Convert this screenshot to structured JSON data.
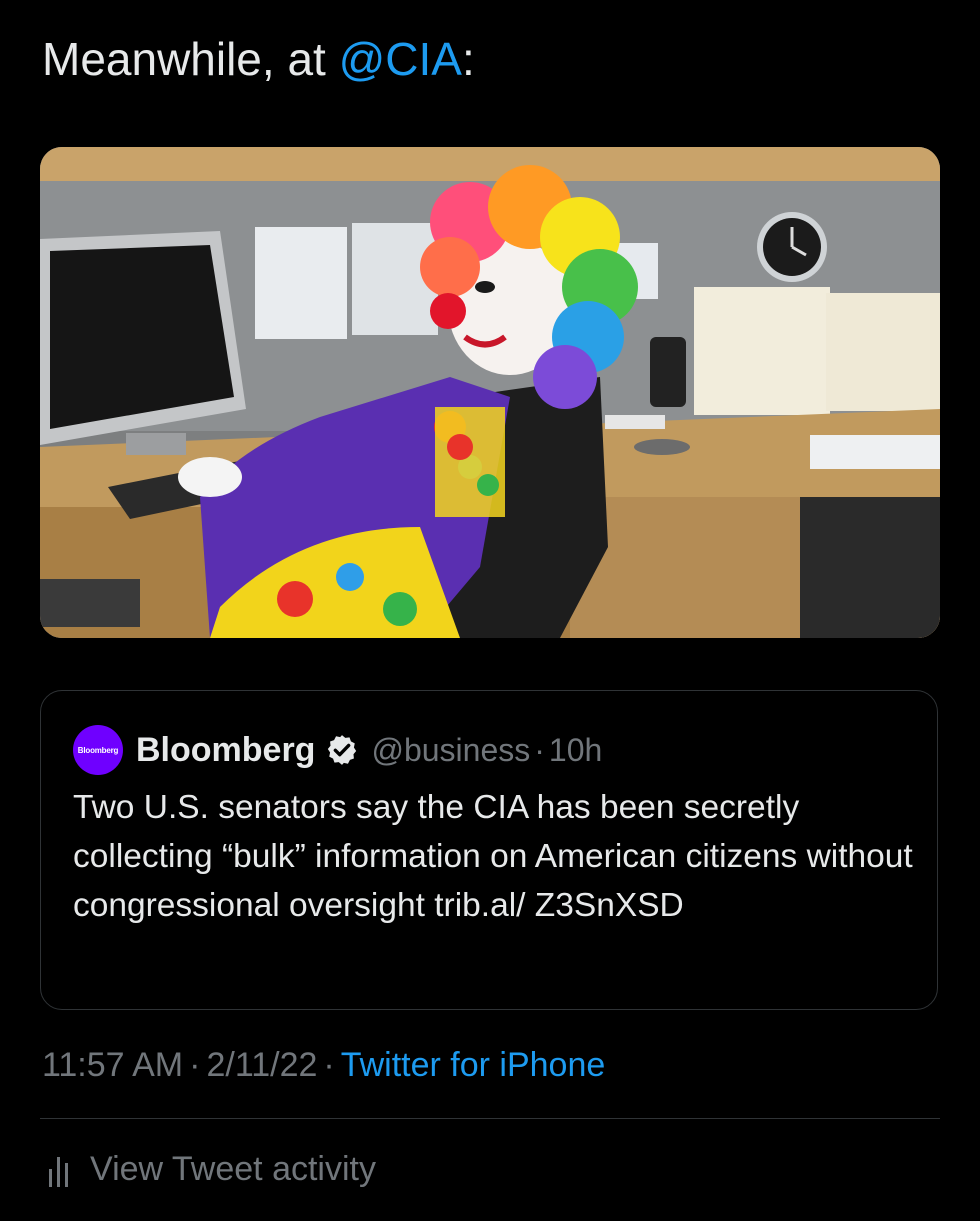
{
  "tweet": {
    "text_prefix": "Meanwhile, at ",
    "mention": "@CIA",
    "text_suffix": ":",
    "timestamp_time": "11:57 AM",
    "timestamp_date": "2/11/22",
    "separator": "·",
    "source": "Twitter for iPhone"
  },
  "media": {
    "alt_icon": "image"
  },
  "quoted_tweet": {
    "avatar_text": "Bloomberg",
    "author_name": "Bloomberg",
    "verified_icon": "verified-badge-icon",
    "handle": "@business",
    "separator": "·",
    "age": "10h",
    "text": "Two U.S. senators say the CIA has been secretly collecting “bulk” information on American citizens without congressional oversight trib.al/ Z3SnXSD"
  },
  "footer": {
    "activity_icon": "bar-chart-icon",
    "activity_label": "View Tweet activity"
  },
  "colors": {
    "background": "#000000",
    "text": "#e7e9ea",
    "muted": "#71767b",
    "link": "#1d9bf0",
    "border": "#2f3336",
    "bloomberg_purple": "#6f00ff"
  }
}
